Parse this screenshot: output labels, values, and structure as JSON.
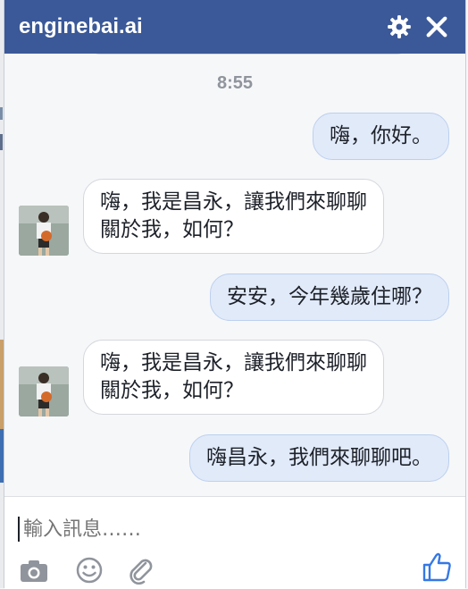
{
  "header": {
    "title": "enginebai.ai",
    "settings_icon": "gear-icon",
    "close_icon": "close-icon"
  },
  "thread": {
    "timestamp": "8:55",
    "messages": [
      {
        "from": "me",
        "text": "嗨，你好。"
      },
      {
        "from": "bot",
        "lines": [
          "嗨，我是昌永，讓我們來聊聊",
          "關於我，如何？"
        ]
      },
      {
        "from": "me",
        "text": "安安，今年幾歲住哪？"
      },
      {
        "from": "bot",
        "lines": [
          "嗨，我是昌永，讓我們來聊聊",
          "關於我，如何？"
        ]
      },
      {
        "from": "me",
        "text": "嗨昌永，我們來聊聊吧。"
      }
    ]
  },
  "composer": {
    "placeholder": "輸入訊息……",
    "icons": [
      "camera-icon",
      "emoji-icon",
      "attachment-icon",
      "like-icon"
    ]
  },
  "colors": {
    "header": "#3b5998",
    "outgoing_bubble": "#e1eaf9",
    "incoming_bubble": "#ffffff",
    "like": "#3578e5"
  }
}
